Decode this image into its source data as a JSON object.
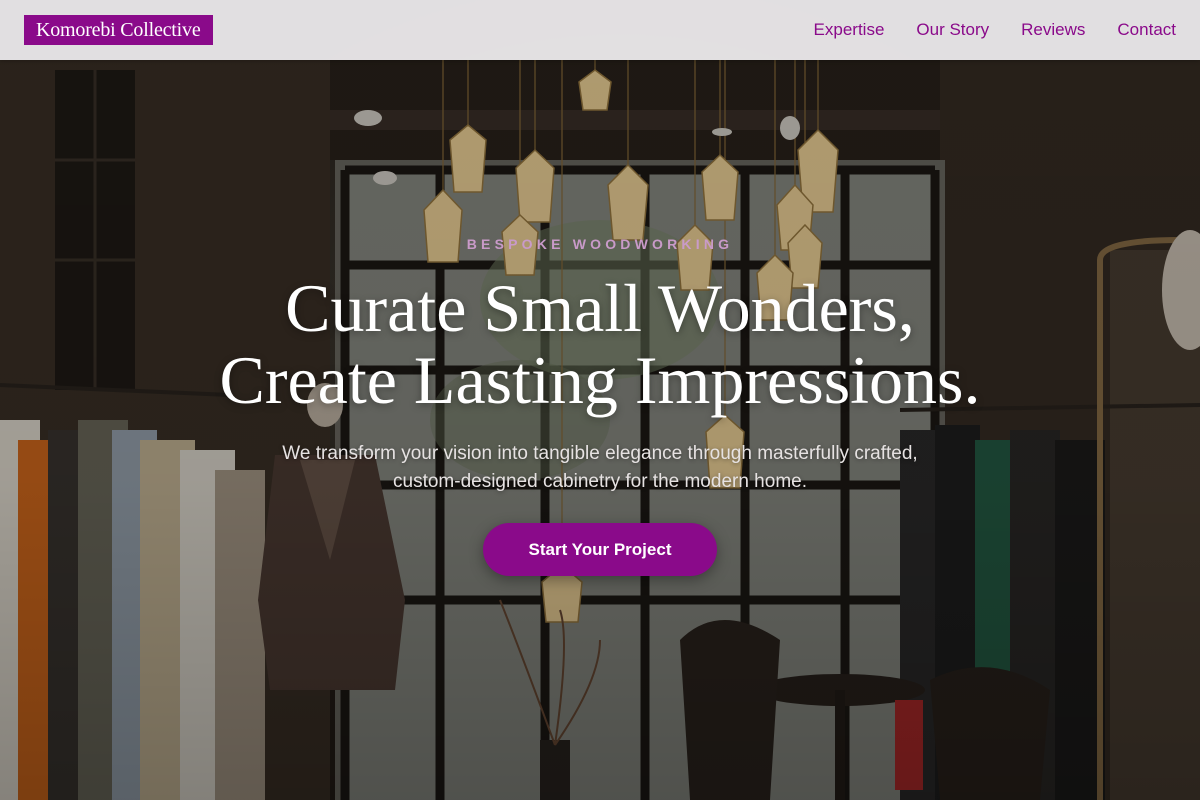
{
  "brand": {
    "name": "Komorebi Collective"
  },
  "nav": {
    "links": [
      {
        "label": "Expertise"
      },
      {
        "label": "Our Story"
      },
      {
        "label": "Reviews"
      },
      {
        "label": "Contact"
      }
    ]
  },
  "hero": {
    "eyebrow": "BESPOKE WOODWORKING",
    "headline_line1": "Curate Small Wonders,",
    "headline_line2": "Create Lasting Impressions.",
    "subtext": "We transform your vision into tangible elegance through masterfully crafted, custom-designed cabinetry for the modern home.",
    "cta_label": "Start Your Project",
    "background_description": "boutique-interior-photo"
  },
  "colors": {
    "accent": "#8a0a8a",
    "nav_background": "#e8e6e8",
    "eyebrow": "#c99ac9",
    "headline": "#ffffff"
  }
}
